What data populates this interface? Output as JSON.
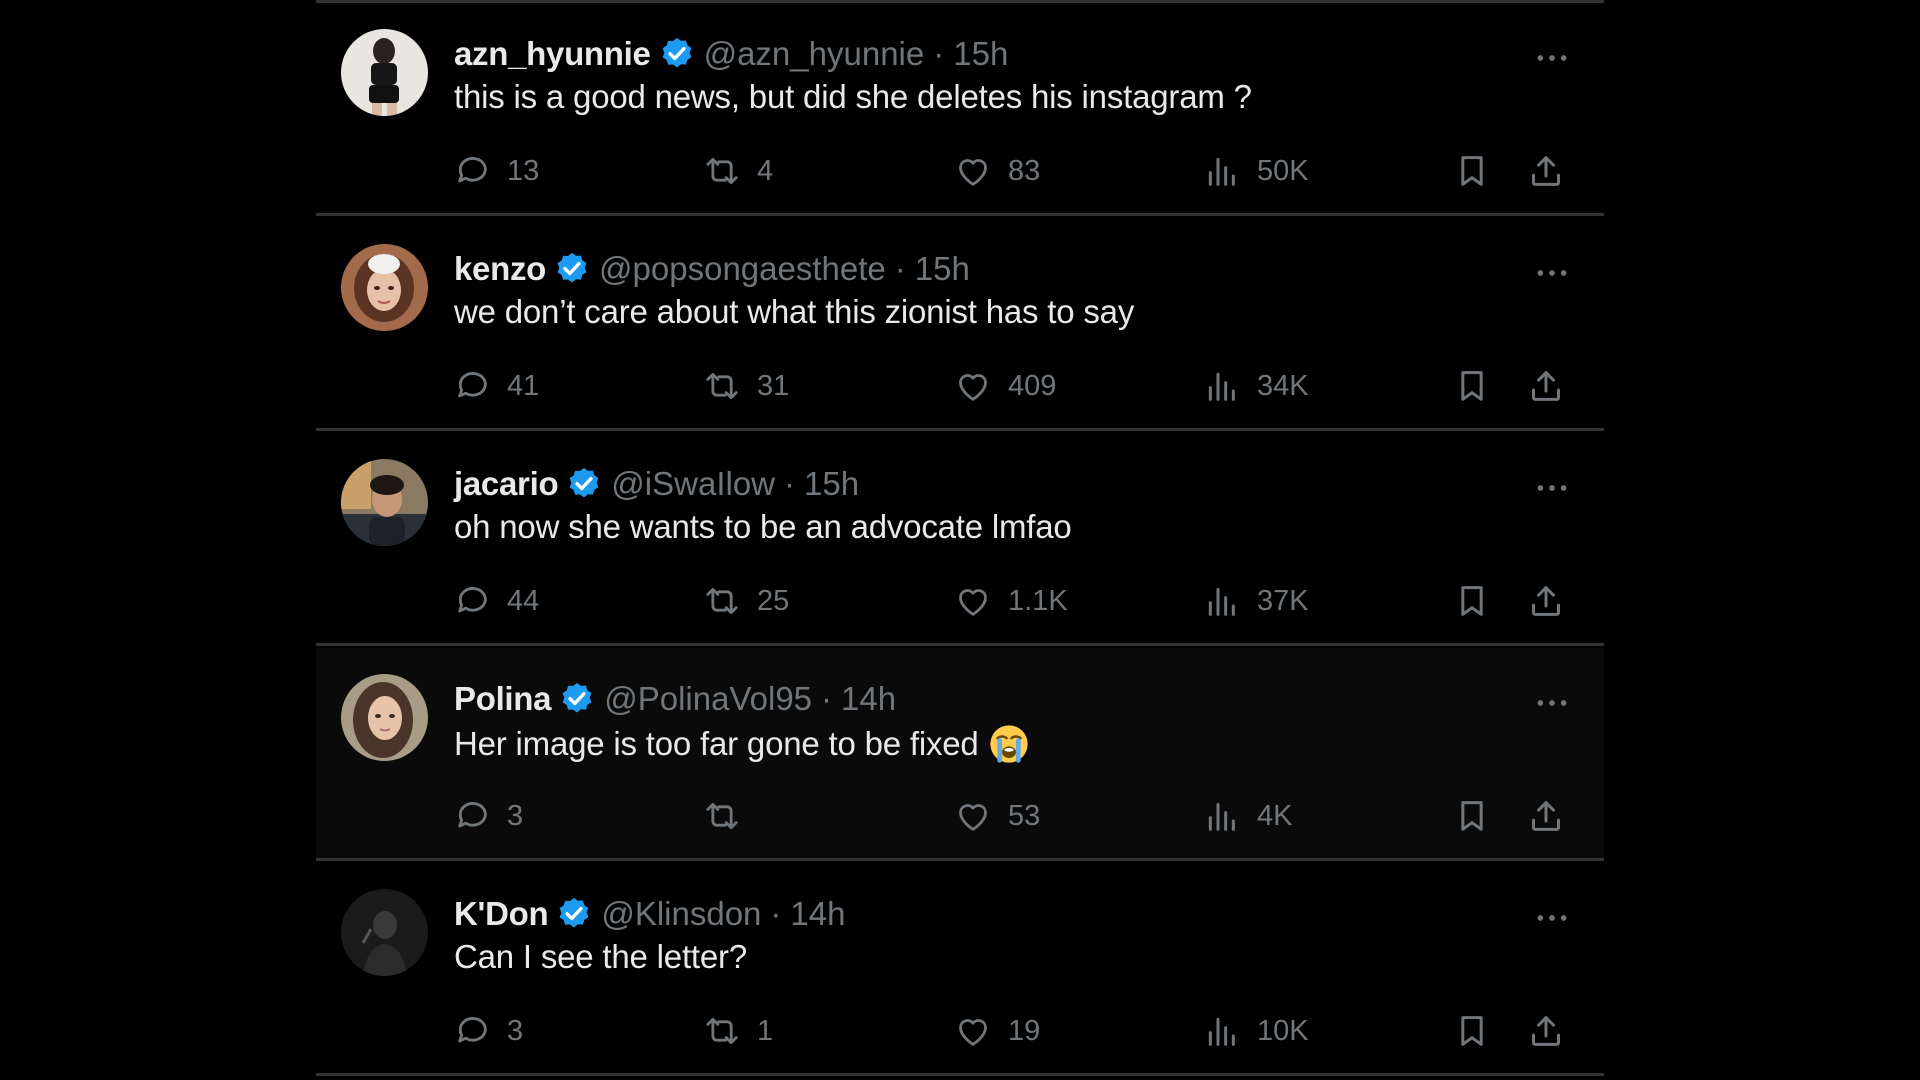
{
  "colors": {
    "background": "#000000",
    "divider": "#2f3336",
    "muted": "#71767b",
    "text": "#e7e9ea",
    "verified": "#1d9bf0"
  },
  "icons": {
    "reply": "comment-bubble-icon",
    "retweet": "retweet-icon",
    "like": "heart-icon",
    "views": "views-bar-chart-icon",
    "bookmark": "bookmark-icon",
    "share": "share-upload-icon",
    "more": "more-dots-icon",
    "verified": "verified-badge-icon"
  },
  "tweets": [
    {
      "name": "azn_hyunnie",
      "handle": "@azn_hyunnie",
      "separator": "·",
      "time": "15h",
      "text": "this is a good news, but did she deletes his instagram ?",
      "replies": "13",
      "retweets": "4",
      "likes": "83",
      "views": "50K"
    },
    {
      "name": "kenzo",
      "handle": "@popsongaesthete",
      "separator": "·",
      "time": "15h",
      "text": "we don’t care about what this zionist has to say",
      "replies": "41",
      "retweets": "31",
      "likes": "409",
      "views": "34K"
    },
    {
      "name": "jacario",
      "handle": "@iSwaIlow",
      "separator": "·",
      "time": "15h",
      "text": "oh now she wants to be an advocate lmfao",
      "replies": "44",
      "retweets": "25",
      "likes": "1.1K",
      "views": "37K"
    },
    {
      "name": "Polina",
      "handle": "@PolinaVol95",
      "separator": "·",
      "time": "14h",
      "text": "Her image is too far gone to be fixed",
      "emoji": "loudly-crying-face",
      "replies": "3",
      "retweets": "",
      "likes": "53",
      "views": "4K"
    },
    {
      "name": "K'Don",
      "handle": "@Klinsdon",
      "separator": "·",
      "time": "14h",
      "text": "Can I see the letter?",
      "replies": "3",
      "retweets": "1",
      "likes": "19",
      "views": "10K"
    }
  ]
}
